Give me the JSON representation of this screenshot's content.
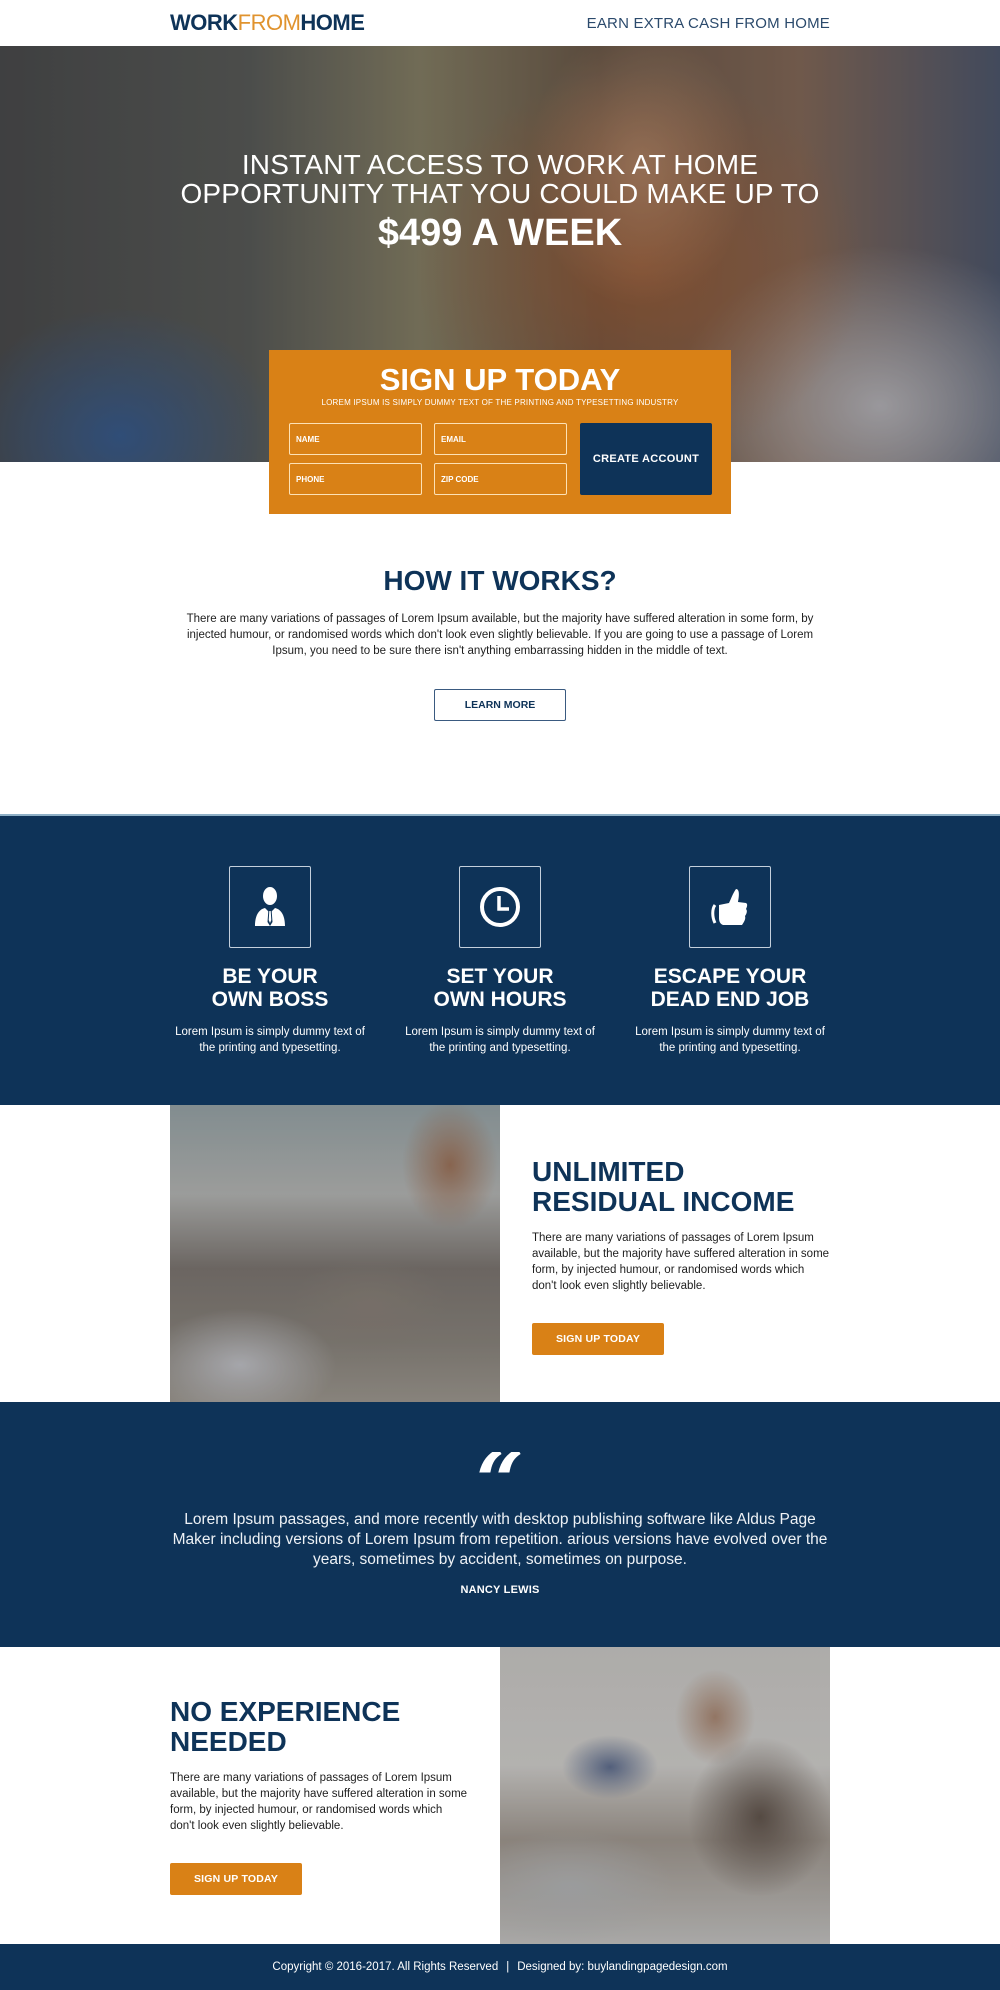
{
  "header": {
    "logo": {
      "part1": "WORK",
      "part2": "FROM",
      "part3": "HOME"
    },
    "tagline": "EARN EXTRA CASH FROM HOME"
  },
  "hero": {
    "line1": "INSTANT ACCESS TO WORK AT HOME",
    "line2": "OPPORTUNITY THAT YOU COULD MAKE UP TO",
    "highlight": "$499 A WEEK"
  },
  "signup_form": {
    "title": "SIGN UP TODAY",
    "subtitle": "LOREM IPSUM IS SIMPLY DUMMY TEXT OF THE PRINTING AND TYPESETTING INDUSTRY",
    "fields": {
      "name": {
        "placeholder": "NAME",
        "value": ""
      },
      "email": {
        "placeholder": "EMAIL",
        "value": ""
      },
      "phone": {
        "placeholder": "PHONE",
        "value": ""
      },
      "zip": {
        "placeholder": "ZIP CODE",
        "value": ""
      }
    },
    "submit_label": "CREATE ACCOUNT"
  },
  "how_it_works": {
    "title": "HOW IT WORKS?",
    "text": "There are many variations of passages of Lorem Ipsum available, but the majority have suffered alteration in some form, by injected humour, or randomised words which don't look even slightly believable. If you are going to use a passage of Lorem Ipsum, you need to be sure there isn't anything embarrassing hidden in the middle of text.",
    "button_label": "LEARN MORE"
  },
  "features": [
    {
      "icon": "businessman-icon",
      "title_line1": "BE YOUR",
      "title_line2": "OWN BOSS",
      "text": "Lorem Ipsum is simply dummy text of the printing and typesetting."
    },
    {
      "icon": "clock-icon",
      "title_line1": "SET YOUR",
      "title_line2": "OWN HOURS",
      "text": "Lorem Ipsum is simply dummy text of the printing and typesetting."
    },
    {
      "icon": "thumbs-up-icon",
      "title_line1": "ESCAPE YOUR",
      "title_line2": "DEAD END JOB",
      "text": "Lorem Ipsum is simply dummy text of the printing and typesetting."
    }
  ],
  "unlimited": {
    "title_line1": "UNLIMITED",
    "title_line2": "RESIDUAL INCOME",
    "text": "There are many variations of passages of Lorem Ipsum available, but the majority have suffered alteration in some form, by injected humour, or randomised words which don't look even slightly believable.",
    "button_label": "SIGN UP TODAY"
  },
  "testimonial": {
    "quote_mark": "“",
    "text": "Lorem Ipsum passages, and more recently with desktop publishing software like Aldus Page Maker including versions of Lorem Ipsum from repetition. arious versions have evolved over the years, sometimes by accident, sometimes on purpose.",
    "author": "NANCY LEWIS"
  },
  "no_experience": {
    "title_line1": "NO EXPERIENCE",
    "title_line2": "NEEDED",
    "text": "There are many variations of passages of Lorem Ipsum available, but the majority have suffered alteration in some form, by injected humour, or randomised words which don't look even slightly believable.",
    "button_label": "SIGN UP TODAY"
  },
  "footer": {
    "copyright": "Copyright © 2016-2017. All Rights Reserved",
    "separator": "|",
    "designed_by": "Designed by: buylandingpagedesign.com"
  },
  "colors": {
    "navy": "#0e3358",
    "orange": "#d98116",
    "logo_accent": "#e0932e"
  }
}
